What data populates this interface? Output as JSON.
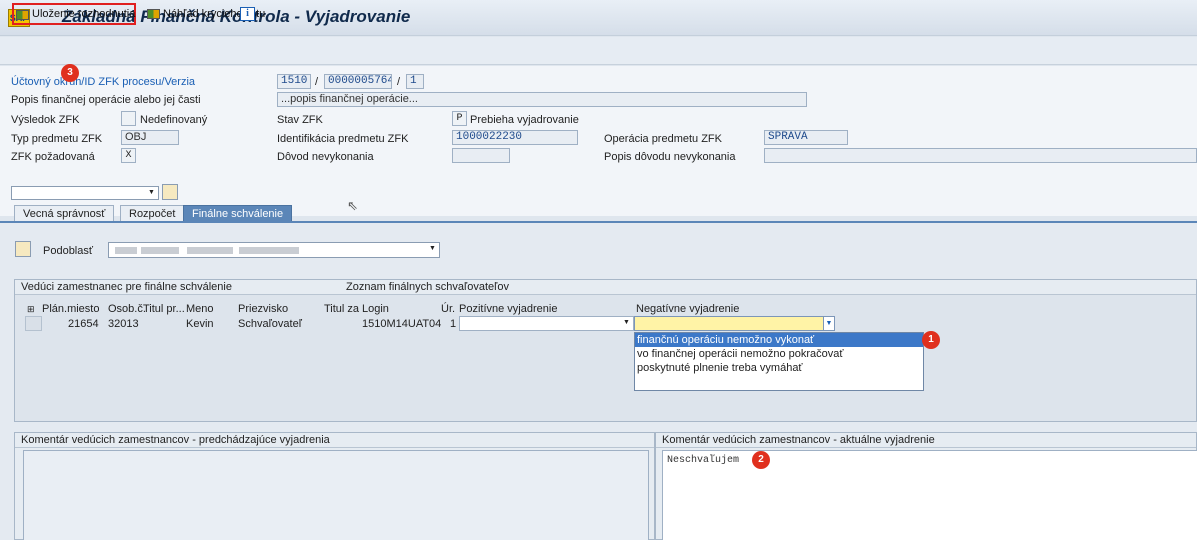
{
  "window": {
    "app_icon_text": "SAP",
    "title": "Základná Finančná Kontrola - Vyjadrovanie"
  },
  "toolbar": {
    "save_label": "Uloženie rozhodnutia",
    "preview_label": "Náhľad krycieho listu",
    "info_icon": "i"
  },
  "badges": {
    "one": "1",
    "two": "2",
    "three": "3"
  },
  "header": {
    "account_label": "Účtovný okruh/ID ZFK procesu/Verzia",
    "account_code": "1510",
    "process_id": "0000005764",
    "version": "1",
    "sep": "/",
    "desc_label": "Popis finančnej operácie alebo jej časti",
    "desc_value": "...popis finančnej operácie...",
    "result_label": "Výsledok ZFK",
    "result_value": "Nedefinovaný",
    "status_label": "Stav ZFK",
    "status_code": "P",
    "status_value": "Prebieha vyjadrovanie",
    "subject_type_label": "Typ predmetu ZFK",
    "subject_type_value": "OBJ",
    "subject_id_label": "Identifikácia predmetu ZFK",
    "subject_id_value": "1000022230",
    "operation_label": "Operácia predmetu ZFK",
    "operation_value": "SPRAVA",
    "required_label": "ZFK požadovaná",
    "required_value": "X",
    "reason_label": "Dôvod nevykonania",
    "reason_desc_label": "Popis dôvodu nevykonania"
  },
  "tabs": [
    {
      "label": "Vecná správnosť"
    },
    {
      "label": "Rozpočet"
    },
    {
      "label": "Finálne schválenie"
    }
  ],
  "subarea": {
    "label": "Podoblasť"
  },
  "approvers": {
    "group_title": "Vedúci zamestnanec pre finálne schválenie",
    "list_title": "Zoznam finálnych schvaľovateľov",
    "columns": [
      "Plán.miesto",
      "Osob.č.",
      "Titul pr...",
      "Meno",
      "Priezvisko",
      "Titul za",
      "Login",
      "Úr.",
      "Pozitívne vyjadrenie",
      "Negatívne vyjadrenie"
    ],
    "row": {
      "plan": "21654",
      "osob": "32013",
      "titul_pr": "",
      "meno": "Kevin",
      "priezvisko": "Schvaľovateľ",
      "titul_za": "",
      "login": "1510M14UAT04",
      "ur": "1",
      "positive": "",
      "negative": ""
    },
    "dropdown_options": [
      "finančnú operáciu nemožno vykonať",
      "vo finančnej operácii nemožno pokračovať",
      "poskytnuté plnenie treba vymáhať"
    ]
  },
  "comments": {
    "previous_title": "Komentár vedúcich zamestnancov - predchádzajúce vyjadrenia",
    "current_title": "Komentár vedúcich zamestnancov - aktuálne vyjadrenie",
    "current_text": "Neschvaľujem"
  }
}
